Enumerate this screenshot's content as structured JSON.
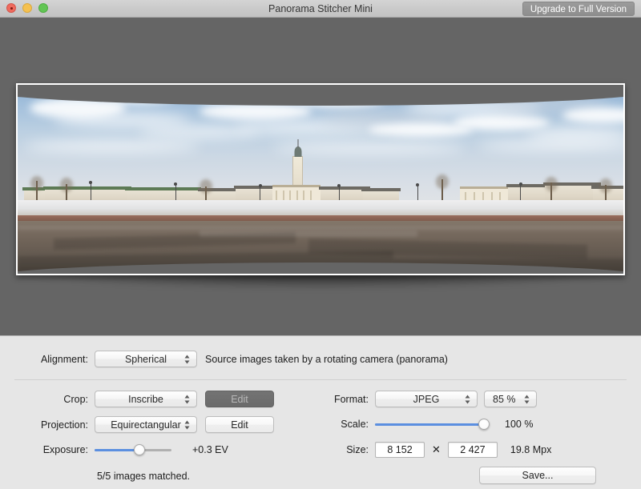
{
  "window": {
    "title": "Panorama Stitcher Mini",
    "upgrade_label": "Upgrade to Full Version",
    "traffic_lights": [
      "close-button",
      "minimize-button",
      "zoom-button"
    ]
  },
  "preview": {
    "alt": "Stitched panorama of a snowy town square with a classical fire tower, arcaded trading rows and a large open plaza"
  },
  "controls": {
    "alignment": {
      "label": "Alignment:",
      "value": "Spherical",
      "description": "Source images taken by a rotating camera (panorama)"
    },
    "crop": {
      "label": "Crop:",
      "value": "Inscribe",
      "edit_label": "Edit"
    },
    "projection": {
      "label": "Projection:",
      "value": "Equirectangular",
      "edit_label": "Edit"
    },
    "exposure": {
      "label": "Exposure:",
      "value": "+0.3 EV",
      "slider_percent": 58
    },
    "status": "5/5 images matched.",
    "format": {
      "label": "Format:",
      "value": "JPEG",
      "quality": "85 %"
    },
    "scale": {
      "label": "Scale:",
      "value": "100 %",
      "slider_percent": 100
    },
    "size": {
      "label": "Size:",
      "width": "8 152",
      "separator": "✕",
      "height": "2 427",
      "megapixels": "19.8 Mpx"
    },
    "save_label": "Save..."
  },
  "colors": {
    "accent": "#5b8fe0",
    "panel_bg": "#e6e6e6",
    "preview_bg": "#656565",
    "titlebar_bg": "#cacaca"
  }
}
